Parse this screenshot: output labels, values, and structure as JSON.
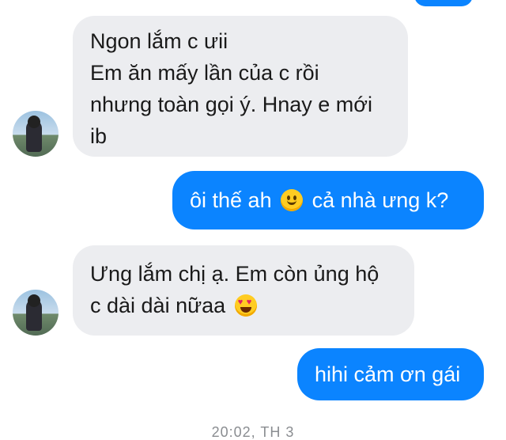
{
  "messages": [
    {
      "direction": "incoming",
      "lines": [
        "Ngon lắm c ưii",
        "Em ăn mấy lần của c rồi",
        "nhưng toàn gọi ý. Hnay e mới",
        "ib"
      ]
    },
    {
      "direction": "outgoing",
      "text_before": "ôi thế ah",
      "emoji": "slightly-smiling-face-emoji",
      "text_after": "cả nhà ưng k?"
    },
    {
      "direction": "incoming",
      "lines": [
        "Ưng lắm chị ạ. Em còn ủng hộ",
        "c dài dài nữaa"
      ],
      "emoji": "heart-eyes-emoji"
    },
    {
      "direction": "outgoing",
      "text": "hihi cảm ơn gái"
    }
  ],
  "timestamp": "20:02, TH 3",
  "colors": {
    "incoming_bubble": "#ecedf0",
    "outgoing_bubble": "#0b84ff",
    "outgoing_text": "#ffffff",
    "incoming_text": "#1a1a1a",
    "timestamp_text": "#8a8d91"
  }
}
